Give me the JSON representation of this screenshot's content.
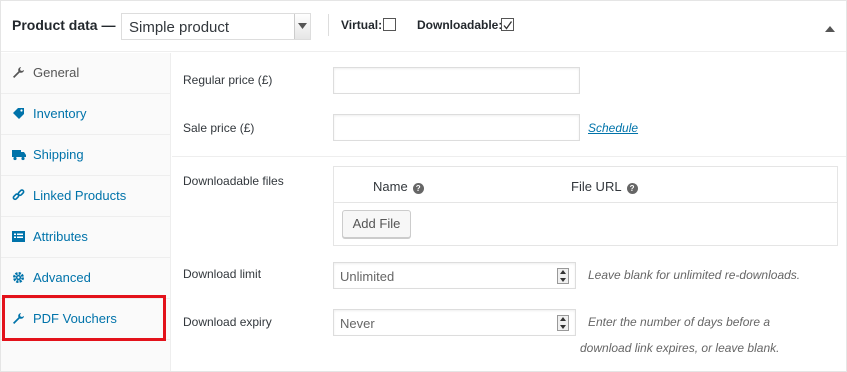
{
  "header": {
    "title": "Product data —",
    "product_type": "Simple product",
    "virtual_label": "Virtual:",
    "virtual_checked": false,
    "downloadable_label": "Downloadable:",
    "downloadable_checked": true
  },
  "sidebar": {
    "items": [
      {
        "label": "General",
        "icon": "wrench-icon"
      },
      {
        "label": "Inventory",
        "icon": "tag-icon"
      },
      {
        "label": "Shipping",
        "icon": "truck-icon"
      },
      {
        "label": "Linked Products",
        "icon": "link-icon"
      },
      {
        "label": "Attributes",
        "icon": "list-icon"
      },
      {
        "label": "Advanced",
        "icon": "gear-icon"
      },
      {
        "label": "PDF Vouchers",
        "icon": "wrench-icon"
      }
    ],
    "highlight_color": "#e3121b"
  },
  "pricing": {
    "regular_label": "Regular price (£)",
    "regular_value": "",
    "sale_label": "Sale price (£)",
    "sale_value": "",
    "schedule_link": "Schedule"
  },
  "downloads": {
    "files_label": "Downloadable files",
    "col_name": "Name",
    "col_url": "File URL",
    "help_glyph": "?",
    "add_file_button": "Add File",
    "limit_label": "Download limit",
    "limit_placeholder": "Unlimited",
    "limit_hint": "Leave blank for unlimited re-downloads.",
    "expiry_label": "Download expiry",
    "expiry_placeholder": "Never",
    "expiry_hint_line1": "Enter the number of days before a",
    "expiry_hint_line2": "download link expires, or leave blank."
  },
  "colors": {
    "link": "#0073aa",
    "text": "#32373c"
  }
}
